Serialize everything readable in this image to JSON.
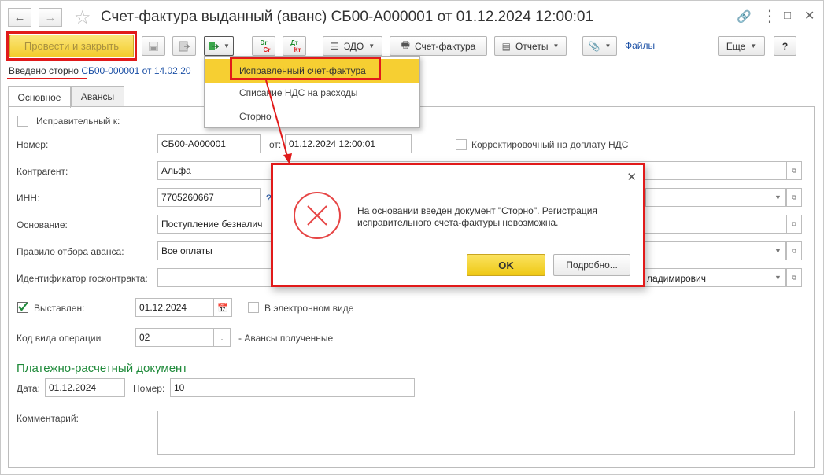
{
  "window": {
    "title": "Счет-фактура выданный (аванс) СБ00-А000001 от 01.12.2024 12:00:01"
  },
  "toolbar": {
    "post_close": "Провести и закрыть",
    "edo": "ЭДО",
    "invoice": "Счет-фактура",
    "reports": "Отчеты",
    "files": "Файлы",
    "more": "Еще",
    "help": "?",
    "dt_kt_top": "Dr",
    "dt_kt_bottom": "Cr",
    "dt_top_ru": "Дт",
    "dt_bottom_ru": "Кт"
  },
  "storno_notice": {
    "prefix": "Введено сторно",
    "link": "СБ00-000001 от 14.02.20"
  },
  "tabs": [
    {
      "label": "Основное"
    },
    {
      "label": "Авансы"
    }
  ],
  "form": {
    "corrective_label": "Исправительный к:",
    "number_label": "Номер:",
    "number_value": "СБ00-А000001",
    "date_from_label": "от:",
    "date_value": "01.12.2024 12:00:01",
    "correction_vat_label": "Корректировочный на доплату НДС",
    "contractor_label": "Контрагент:",
    "contractor_value": "Альфа",
    "inn_label": "ИНН:",
    "inn_value": "7705260667",
    "basis_label": "Основание:",
    "basis_value": "Поступление безналич",
    "advance_rule_label": "Правило отбора аванса:",
    "advance_rule_value": "Все оплаты",
    "contract_id_label": "Идентификатор госконтракта:",
    "contract_tail_value": "ладимирович",
    "issued_label": "Выставлен:",
    "issued_date": "01.12.2024",
    "electronic_label": "В электронном виде",
    "op_code_label": "Код вида операции",
    "op_code_value": "02",
    "op_code_desc": "- Авансы полученные",
    "payment_section": "Платежно-расчетный документ",
    "pay_date_label": "Дата:",
    "pay_date_value": "01.12.2024",
    "pay_number_label": "Номер:",
    "pay_number_value": "10",
    "comment_label": "Комментарий:",
    "dots": "..."
  },
  "dropdown": {
    "items": [
      {
        "label": "Исправленный счет-фактура"
      },
      {
        "label": "Списание НДС на расходы"
      },
      {
        "label": "Сторно"
      }
    ]
  },
  "dialog": {
    "message": "На основании введен документ \"Сторно\". Регистрация исправительного счета-фактуры невозможна.",
    "ok": "OK",
    "details": "Подробно..."
  },
  "colors": {
    "highlight_red": "#e11a1a",
    "accent_yellow": "#f6cf32",
    "section_green": "#1f8a3a",
    "link_blue": "#1a4fa5"
  }
}
